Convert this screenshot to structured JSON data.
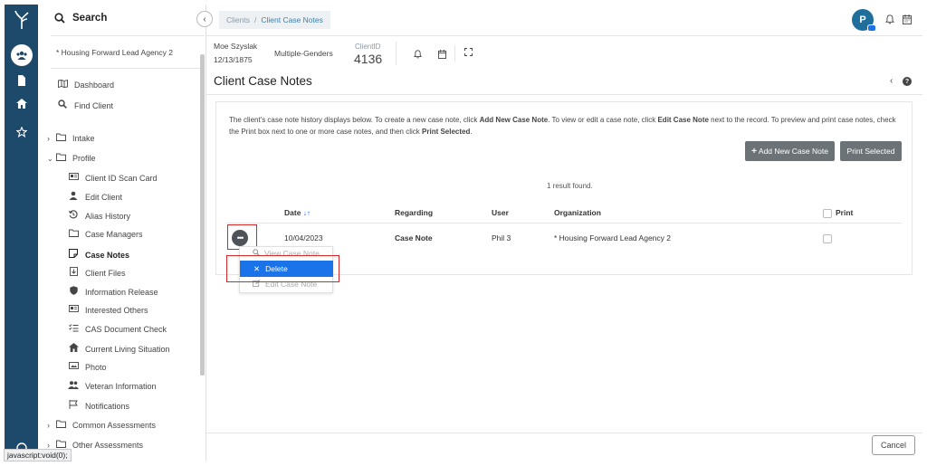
{
  "sidebar": {
    "search_label": "Search",
    "agency": "* Housing Forward Lead Agency 2",
    "items": [
      {
        "label": "Dashboard"
      },
      {
        "label": "Find Client"
      },
      {
        "label": "Intake"
      },
      {
        "label": "Profile"
      },
      {
        "label": "Client ID Scan Card"
      },
      {
        "label": "Edit Client"
      },
      {
        "label": "Alias History"
      },
      {
        "label": "Case Managers"
      },
      {
        "label": "Case Notes"
      },
      {
        "label": "Client Files"
      },
      {
        "label": "Information Release"
      },
      {
        "label": "Interested Others"
      },
      {
        "label": "CAS Document Check"
      },
      {
        "label": "Current Living Situation"
      },
      {
        "label": "Photo"
      },
      {
        "label": "Veteran Information"
      },
      {
        "label": "Notifications"
      },
      {
        "label": "Common Assessments"
      },
      {
        "label": "Other Assessments"
      }
    ]
  },
  "header": {
    "breadcrumb_root": "Clients",
    "breadcrumb_sep": "/",
    "breadcrumb_current": "Client Case Notes",
    "avatar_letter": "P"
  },
  "client": {
    "name": "Moe Szyslak",
    "dob": "12/13/1875",
    "gender": "Multiple-Genders",
    "id_label": "ClientID",
    "id_value": "4136"
  },
  "page": {
    "title": "Client Case Notes",
    "desc_1": "The client's case note history displays below. To create a new case note, click ",
    "desc_b1": "Add New Case Note",
    "desc_2": ". To view or edit a case note, click ",
    "desc_b2": "Edit Case Note",
    "desc_3": " next to the record.  To preview and print case notes, check the Print box next to one or more case notes, and then click ",
    "desc_b3": "Print Selected",
    "desc_4": ".",
    "add_button": "Add New Case Note",
    "print_button": "Print Selected",
    "result_count": "1 result found.",
    "cancel_button": "Cancel"
  },
  "table": {
    "columns": [
      "Date",
      "Regarding",
      "User",
      "Organization",
      "Print"
    ],
    "rows": [
      {
        "date": "10/04/2023",
        "regarding": "Case Note",
        "user": "Phil 3",
        "organization": "* Housing Forward Lead Agency 2"
      }
    ]
  },
  "row_menu": {
    "items": [
      "View Case Note",
      "Delete",
      "Edit Case Note"
    ]
  },
  "status_bar": "javascript:void(0);",
  "colors": {
    "rail": "#1d4a6b",
    "accent": "#1a73e8",
    "avatar": "#1f6e9c",
    "highlight_box": "#d62828"
  }
}
